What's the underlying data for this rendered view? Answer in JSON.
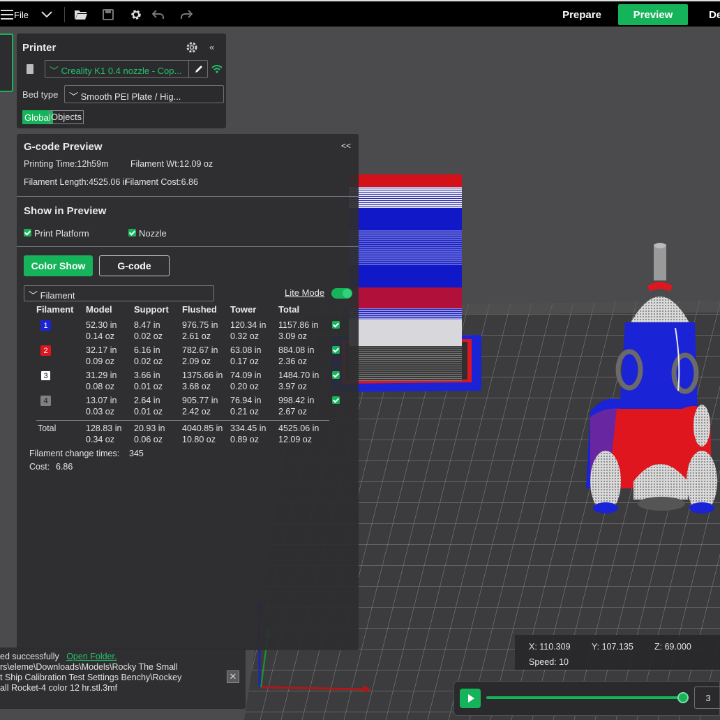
{
  "topbar": {
    "file_label": "File",
    "tabs": {
      "prepare": "Prepare",
      "preview": "Preview",
      "device": "Device"
    }
  },
  "printer": {
    "title": "Printer",
    "printer_name": "Creality K1 0.4 nozzle - Cop...",
    "bed_label": "Bed type",
    "bed_value": "Smooth PEI Plate / Hig...",
    "tab_global": "Global",
    "tab_objects": "Objects"
  },
  "gcode": {
    "title": "G-code Preview",
    "collapse": "<<",
    "printing_time": "Printing Time:12h59m",
    "filament_wt": "Filament Wt:12.09 oz",
    "filament_length": "Filament Length:4525.06 in",
    "filament_cost": "Filament Cost:6.86",
    "show_title": "Show in Preview",
    "print_platform": "Print Platform",
    "nozzle": "Nozzle",
    "color_show": "Color Show",
    "gcode_btn": "G-code",
    "filter": "Filament",
    "lite_mode": "Lite Mode",
    "headers": [
      "Filament",
      "Model",
      "Support",
      "Flushed",
      "Tower",
      "Total"
    ],
    "rows": [
      {
        "id": "1",
        "color": "#1a23d6",
        "text_color": "#ffffff",
        "model": [
          "52.30 in",
          "0.14 oz"
        ],
        "support": [
          "8.47 in",
          "0.02 oz"
        ],
        "flushed": [
          "976.75 in",
          "2.61 oz"
        ],
        "tower": [
          "120.34 in",
          "0.32 oz"
        ],
        "total": [
          "1157.86 in",
          "3.09 oz"
        ]
      },
      {
        "id": "2",
        "color": "#e0161e",
        "text_color": "#ffffff",
        "model": [
          "32.17 in",
          "0.09 oz"
        ],
        "support": [
          "6.16 in",
          "0.02 oz"
        ],
        "flushed": [
          "782.67 in",
          "2.09 oz"
        ],
        "tower": [
          "63.08 in",
          "0.17 oz"
        ],
        "total": [
          "884.08 in",
          "2.36 oz"
        ]
      },
      {
        "id": "3",
        "color": "#ffffff",
        "text_color": "#111111",
        "model": [
          "31.29 in",
          "0.08 oz"
        ],
        "support": [
          "3.66 in",
          "0.01 oz"
        ],
        "flushed": [
          "1375.66 in",
          "3.68 oz"
        ],
        "tower": [
          "74.09 in",
          "0.20 oz"
        ],
        "total": [
          "1484.70 in",
          "3.97 oz"
        ]
      },
      {
        "id": "4",
        "color": "#808080",
        "text_color": "#1a1a1a",
        "model": [
          "13.07 in",
          "0.03 oz"
        ],
        "support": [
          "2.64 in",
          "0.01 oz"
        ],
        "flushed": [
          "905.77 in",
          "2.42 oz"
        ],
        "tower": [
          "76.94 in",
          "0.21 oz"
        ],
        "total": [
          "998.42 in",
          "2.67 oz"
        ]
      }
    ],
    "total_row": {
      "label": "Total",
      "model": [
        "128.83 in",
        "0.34 oz"
      ],
      "support": [
        "20.93 in",
        "0.06 oz"
      ],
      "flushed": [
        "4040.85 in",
        "10.80 oz"
      ],
      "tower": [
        "334.45 in",
        "0.89 oz"
      ],
      "total": [
        "4525.06 in",
        "12.09 oz"
      ]
    },
    "change_times_label": "Filament change times:",
    "change_times": "345",
    "cost_label": "Cost:",
    "cost": "6.86"
  },
  "notification": {
    "line1": "ed successfully",
    "link": "Open Folder.",
    "line2": "rs\\eleme\\Downloads\\Models\\Rocky The Small",
    "line3": "t Ship Calibration Test Settings Benchy\\Rockey",
    "line4": "all Rocket-4 color 12 hr.stl.3mf",
    "close": "✕"
  },
  "coords": {
    "x": "X: 110.309",
    "y": "Y: 107.135",
    "z": "Z: 69.000",
    "speed": "Speed: 10"
  },
  "slider": {
    "value": "3"
  },
  "colors": {
    "accent": "#16b45a",
    "blue": "#1a23d6",
    "red": "#e0161e",
    "white": "#ffffff",
    "grey": "#808080"
  }
}
